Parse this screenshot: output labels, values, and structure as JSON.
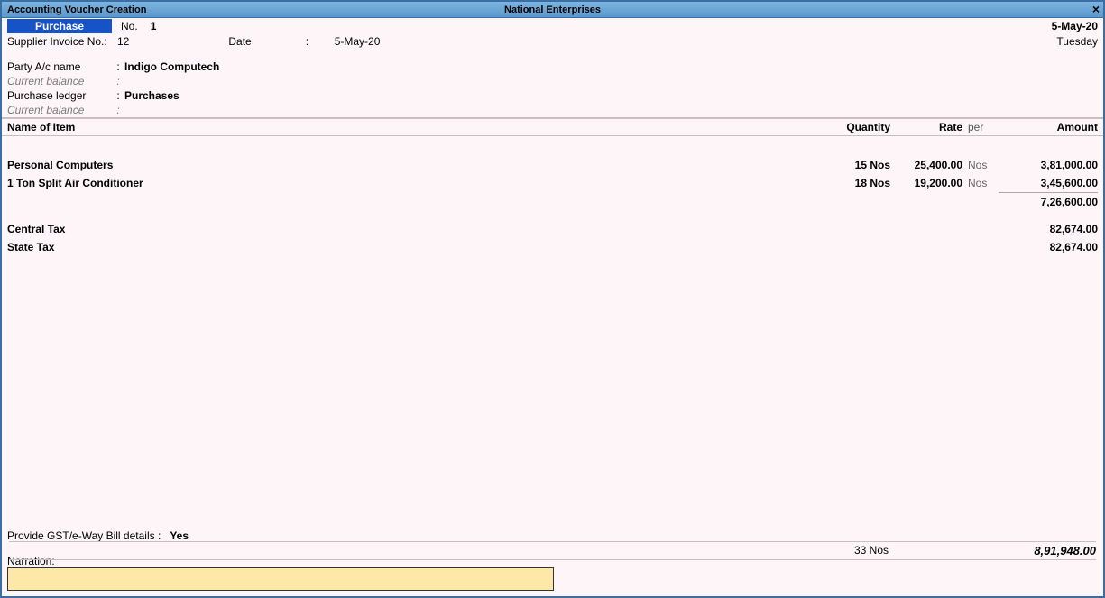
{
  "titlebar": {
    "left": "Accounting Voucher Creation",
    "center": "National Enterprises",
    "close": "×"
  },
  "header": {
    "voucher_type": "Purchase",
    "no_label": "No.",
    "no_value": "1",
    "date": "5-May-20",
    "day": "Tuesday",
    "supplier_inv_label": "Supplier Invoice No.:",
    "supplier_inv_value": "12",
    "date_label": "Date",
    "date_colon": ":",
    "date_value": "5-May-20",
    "party_label": "Party A/c name",
    "party_value": "Indigo Computech",
    "curbal_label": "Current balance",
    "purchase_ledger_label": "Purchase ledger",
    "purchase_ledger_value": "Purchases"
  },
  "grid": {
    "headers": {
      "name": "Name of Item",
      "qty": "Quantity",
      "rate": "Rate",
      "per": "per",
      "amount": "Amount"
    },
    "items": [
      {
        "name": "Personal Computers",
        "qty": "15 Nos",
        "rate": "25,400.00",
        "per": "Nos",
        "amount": "3,81,000.00"
      },
      {
        "name": "1 Ton Split Air Conditioner",
        "qty": "18 Nos",
        "rate": "19,200.00",
        "per": "Nos",
        "amount": "3,45,600.00"
      }
    ],
    "subtotal": "7,26,600.00",
    "taxes": [
      {
        "name": "Central Tax",
        "amount": "82,674.00"
      },
      {
        "name": "State Tax",
        "amount": "82,674.00"
      }
    ]
  },
  "footer": {
    "gst_label": "Provide GST/e-Way Bill details :",
    "gst_value": "Yes",
    "total_qty": "33 Nos",
    "total_amount": "8,91,948.00",
    "narration_label": "Narration:",
    "narration_value": ""
  }
}
